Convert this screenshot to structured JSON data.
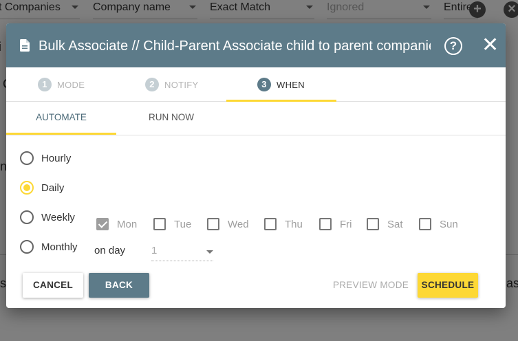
{
  "background": {
    "fields": [
      {
        "label": "t Companies",
        "dim": false
      },
      {
        "label": "Company name",
        "dim": false
      },
      {
        "label": "Exact Match",
        "dim": false
      },
      {
        "label": "Ignored",
        "dim": true
      },
      {
        "label": "Entire",
        "dim": false
      }
    ],
    "add_glyph": "+",
    "remove_glyph": "×",
    "left_letters": [
      "i",
      "C",
      "n",
      "s"
    ],
    "right_letters": [
      "as"
    ]
  },
  "dialog": {
    "title": "Bulk Associate // Child-Parent Associate child to parent companies",
    "help_glyph": "?",
    "close_glyph": "✕",
    "steps": [
      {
        "num": "1",
        "label": "MODE",
        "active": false
      },
      {
        "num": "2",
        "label": "NOTIFY",
        "active": false
      },
      {
        "num": "3",
        "label": "WHEN",
        "active": true
      }
    ],
    "tabs": [
      {
        "label": "AUTOMATE",
        "active": true
      },
      {
        "label": "RUN NOW",
        "active": false
      }
    ],
    "frequency": {
      "options": [
        "Hourly",
        "Daily",
        "Weekly",
        "Monthly"
      ],
      "selected": "Daily"
    },
    "weekdays": [
      {
        "label": "Mon",
        "checked": true
      },
      {
        "label": "Tue",
        "checked": false
      },
      {
        "label": "Wed",
        "checked": false
      },
      {
        "label": "Thu",
        "checked": false
      },
      {
        "label": "Fri",
        "checked": false
      },
      {
        "label": "Sat",
        "checked": false
      },
      {
        "label": "Sun",
        "checked": false
      }
    ],
    "on_day": {
      "label": "on day",
      "value": "1"
    },
    "buttons": {
      "cancel": "CANCEL",
      "back": "BACK",
      "preview": "PREVIEW MODE",
      "schedule": "SCHEDULE"
    }
  },
  "colors": {
    "header": "#5d7b89",
    "accent": "#fdd835"
  }
}
